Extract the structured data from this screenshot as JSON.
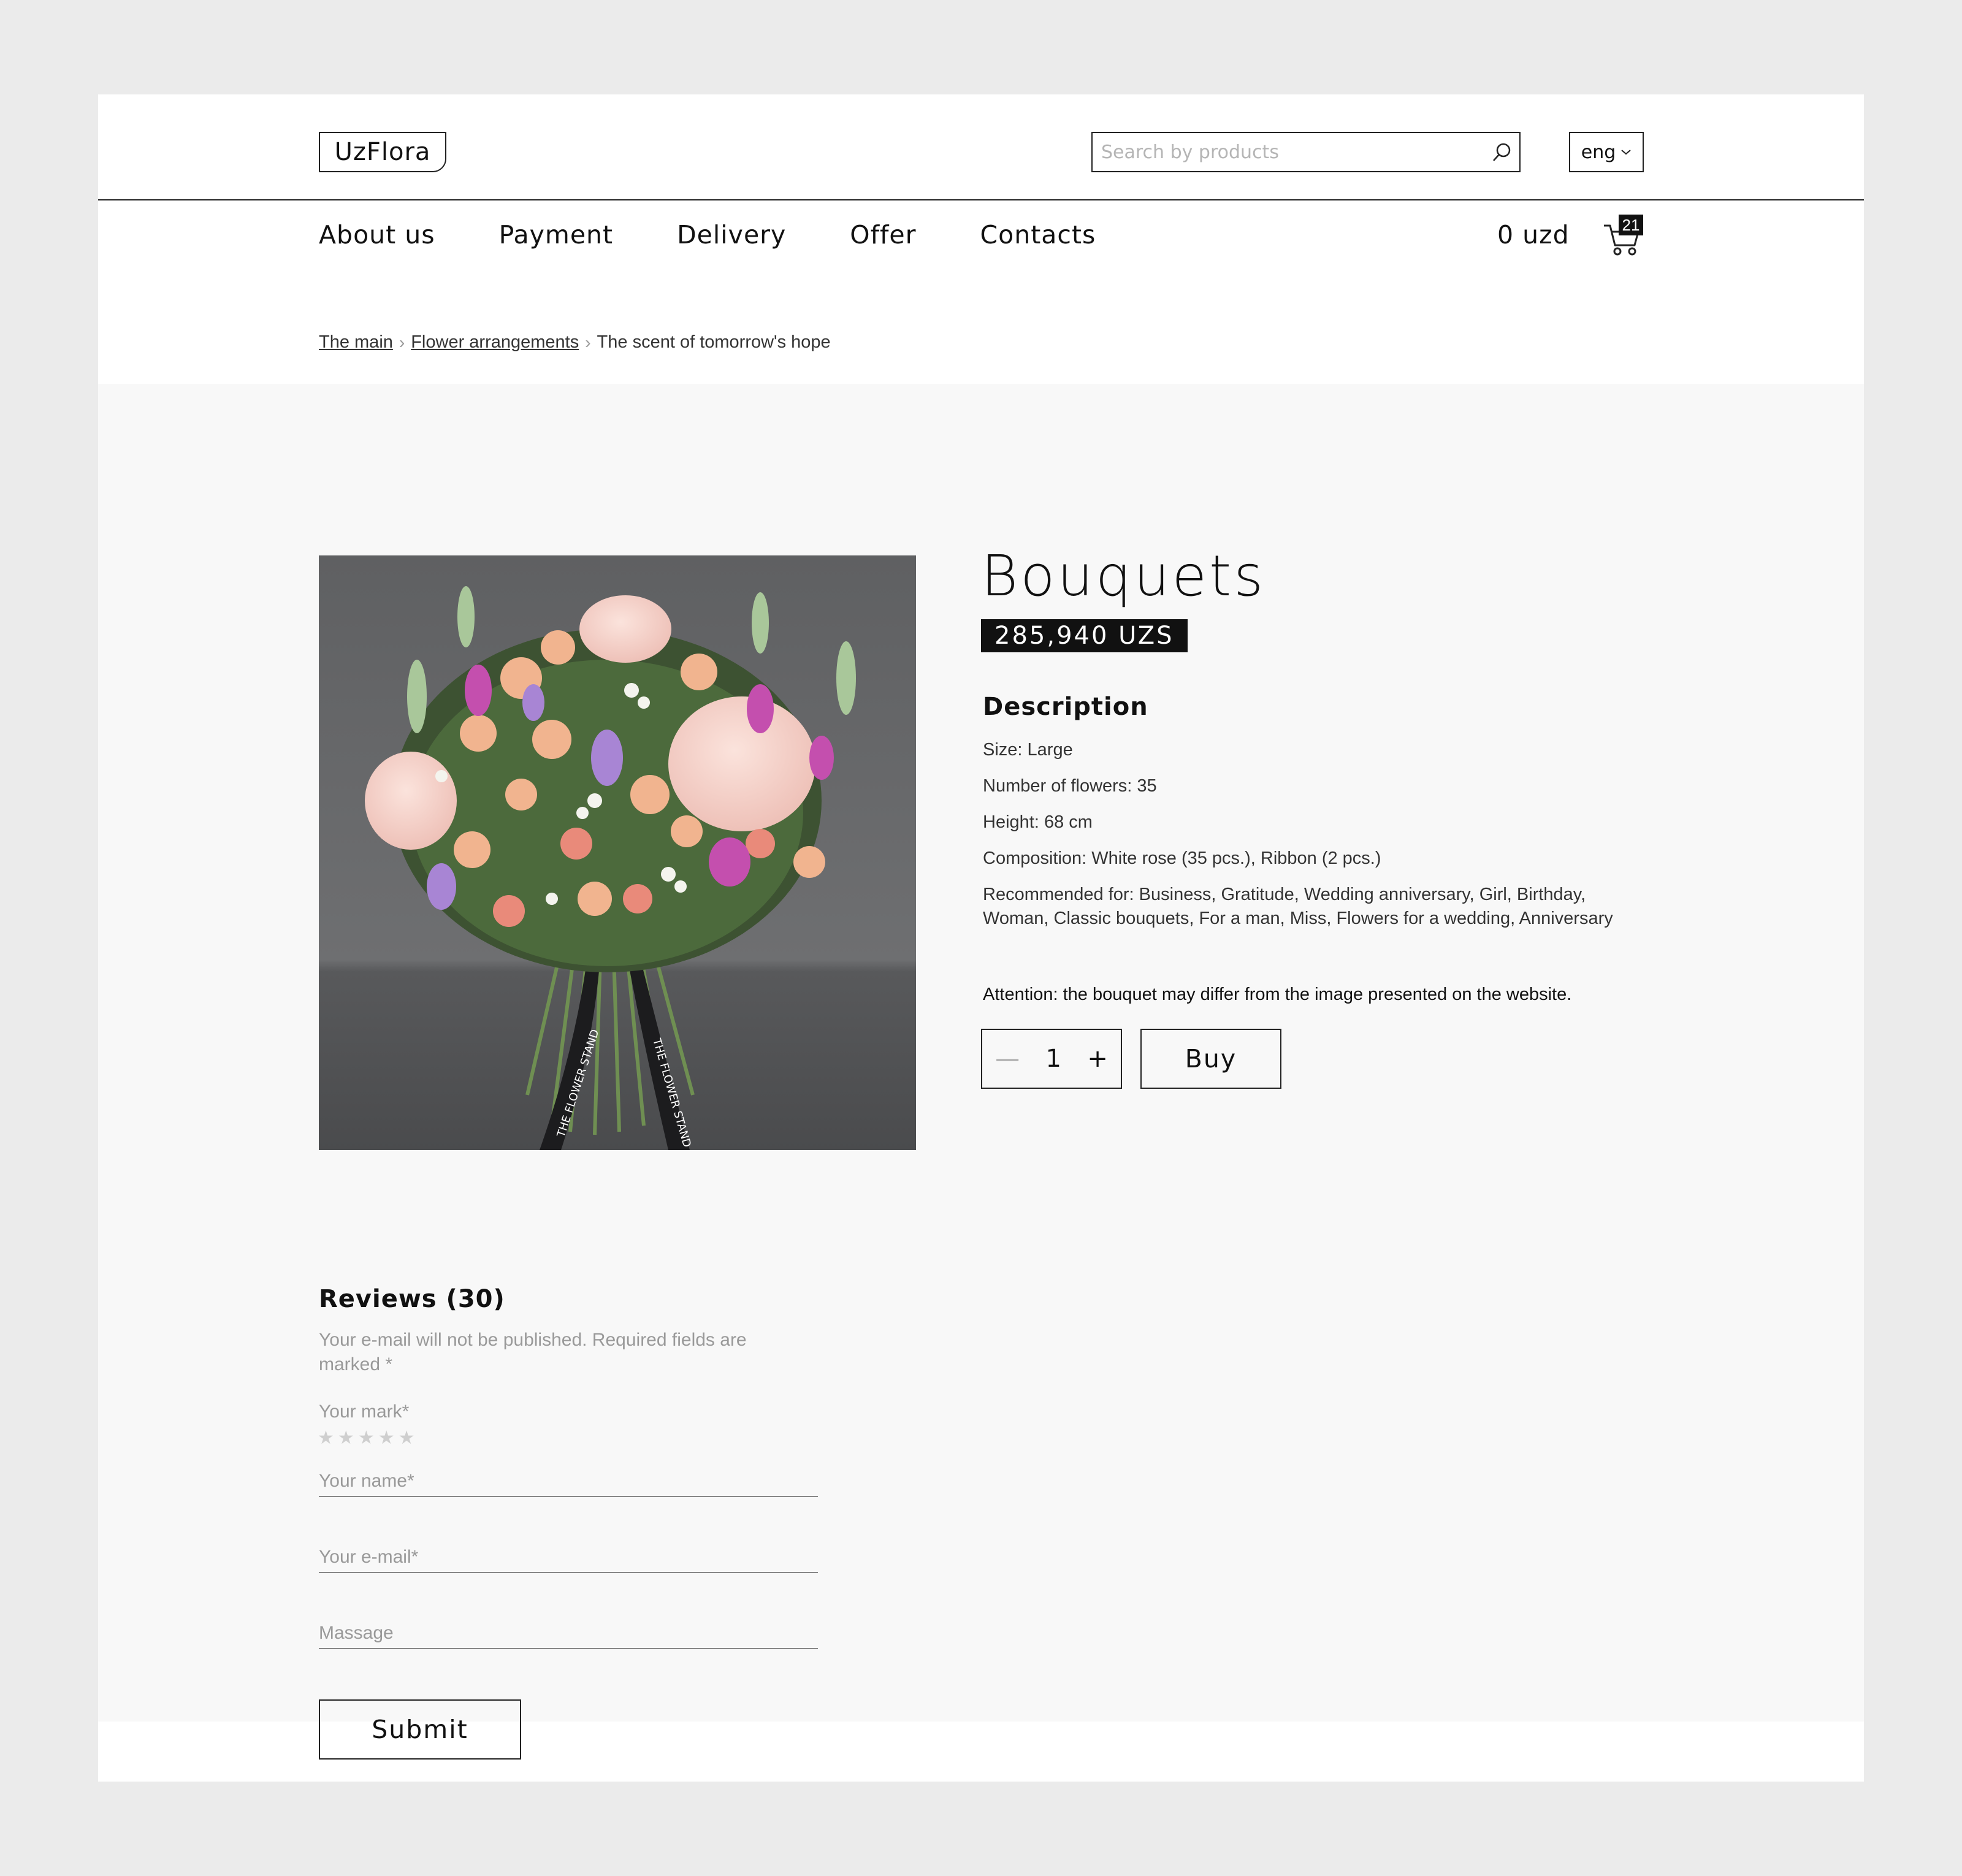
{
  "header": {
    "logo": "UzFlora",
    "search": {
      "placeholder": "Search by products",
      "value": ""
    },
    "language": "eng",
    "nav": [
      "About us",
      "Payment",
      "Delivery",
      "Offer",
      "Contacts"
    ],
    "cart_total": "0 uzd",
    "cart_count": "21"
  },
  "breadcrumb": {
    "items": [
      "The main",
      "Flower arrangements"
    ],
    "current": "The scent of tomorrow's hope"
  },
  "product": {
    "title": "Bouquets",
    "price": "285,940  UZS",
    "description_heading": "Description",
    "details": [
      "Size: Large",
      "Number of flowers: 35",
      "Height: 68 cm",
      "Composition: White rose (35 pcs.), Ribbon (2 pcs.)",
      "Recommended for: Business, Gratitude, Wedding anniversary, Girl, Birthday, Woman, Classic bouquets, For a man, Miss, Flowers for a wedding, Anniversary"
    ],
    "attention": "Attention: the bouquet may differ from the image presented on the website.",
    "quantity": "1",
    "buy_label": "Buy",
    "ribbon_text": "THE FLOWER STAND"
  },
  "reviews": {
    "heading": "Reviews (30)",
    "note": "Your e-mail will not be published. Required fields are marked *",
    "mark_label": "Your mark*",
    "rating": 0,
    "stars_total": 5,
    "name_placeholder": "Your name*",
    "email_placeholder": "Your e-mail*",
    "message_placeholder": "Massage",
    "submit_label": "Submit"
  },
  "colors": {
    "page_bg": "#ebebeb",
    "panel_bg": "#f8f8f8",
    "accent": "#111111"
  }
}
